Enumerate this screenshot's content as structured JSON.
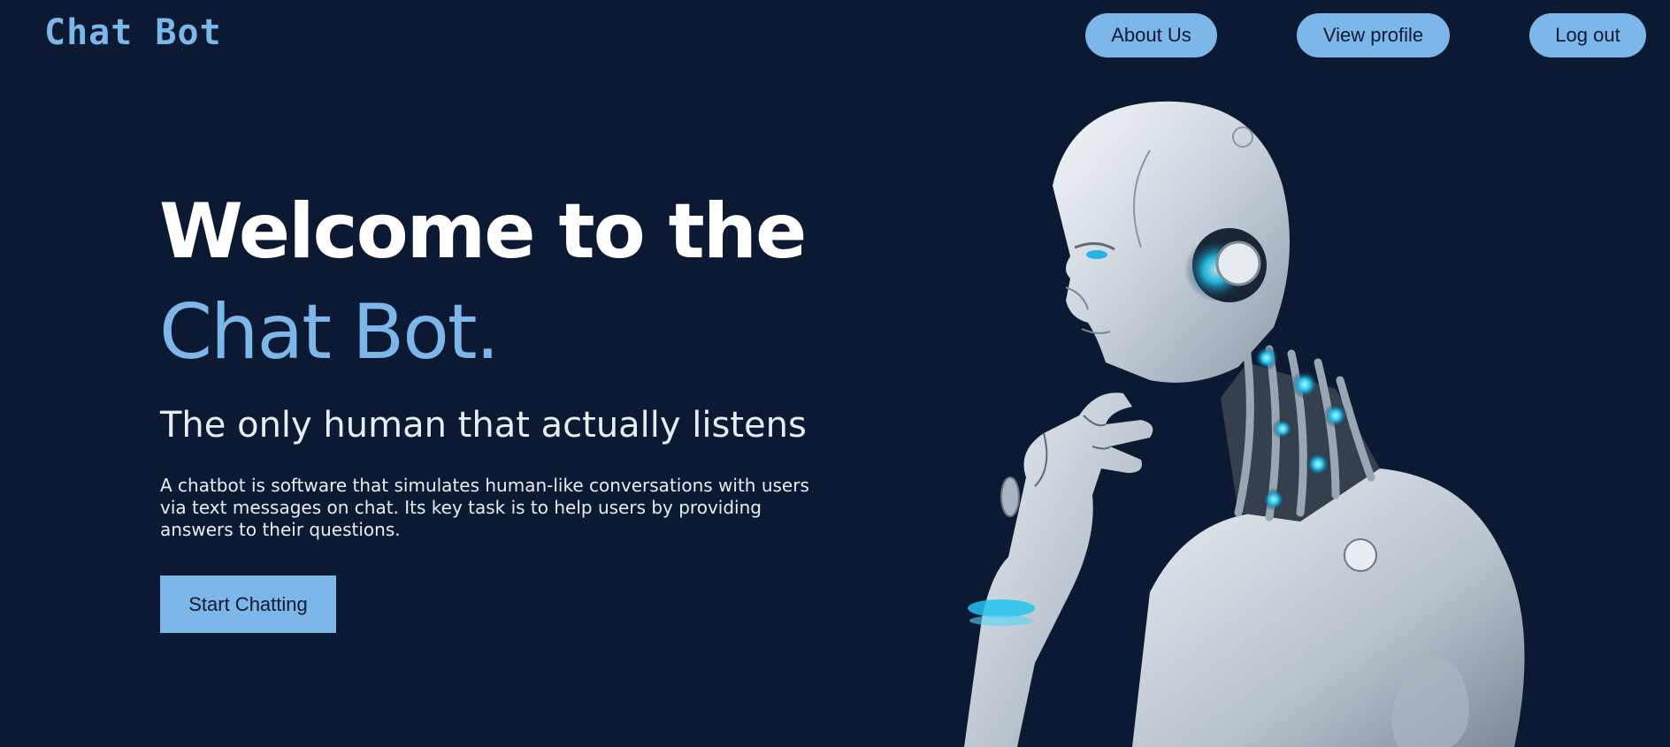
{
  "header": {
    "logo_text": "Chat Bot",
    "nav": {
      "about": "About Us",
      "profile": "View profile",
      "logout": "Log out"
    }
  },
  "hero": {
    "title_line1": "Welcome to the",
    "title_line2": "Chat Bot.",
    "tagline": "The only human that actually listens",
    "description": "A chatbot is software that simulates human-like conversations with users via text messages on chat. Its key task is to help users by providing answers to their questions.",
    "cta_label": "Start Chatting"
  },
  "colors": {
    "background": "#0b1932",
    "accent": "#7db6e8",
    "text": "#ffffff",
    "glow": "#22c3ee"
  },
  "image": {
    "subject": "robot-thinking-illustration"
  }
}
